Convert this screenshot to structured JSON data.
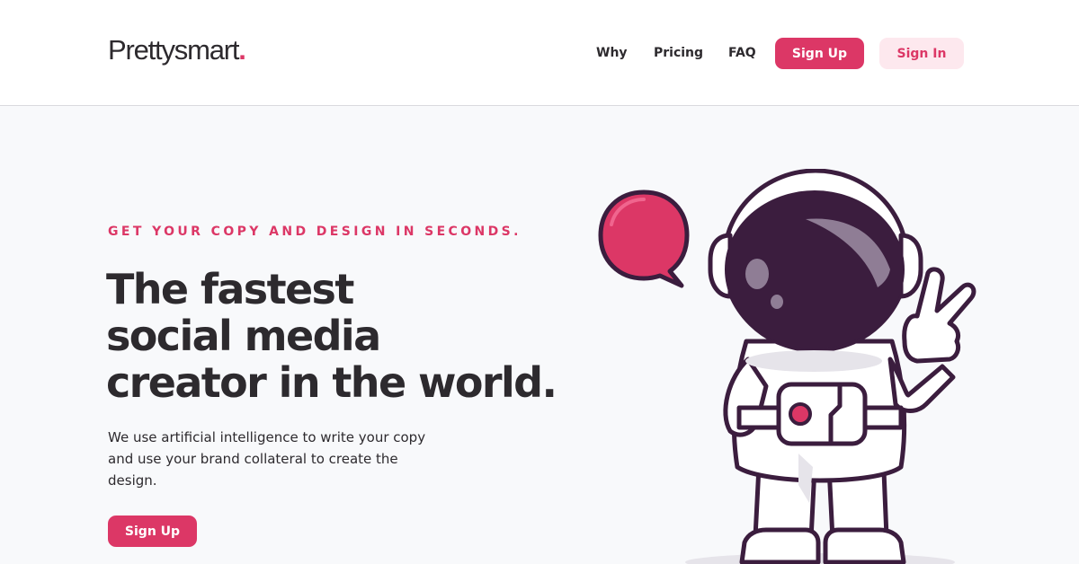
{
  "brand": {
    "name": "Prettysmart",
    "dot": "."
  },
  "nav": {
    "links": [
      "Why",
      "Pricing",
      "FAQ"
    ],
    "signup_label": "Sign Up",
    "signin_label": "Sign In"
  },
  "hero": {
    "eyebrow": "GET YOUR COPY AND DESIGN IN SECONDS.",
    "headline_lines": [
      "The fastest",
      "social media",
      "creator in the world."
    ],
    "subtext": "We use artificial intelligence to write your copy and use your brand collateral to create the design.",
    "cta_label": "Sign Up"
  },
  "colors": {
    "accent": "#dc3766",
    "text": "#2d2a2e",
    "hero_bg": "#f8f9fb",
    "ghost_bg": "#fde8ee",
    "visor": "#3b1d3e"
  },
  "illustration": {
    "subject": "astronaut-peace-sign",
    "bubble": "speech-bubble-icon"
  }
}
